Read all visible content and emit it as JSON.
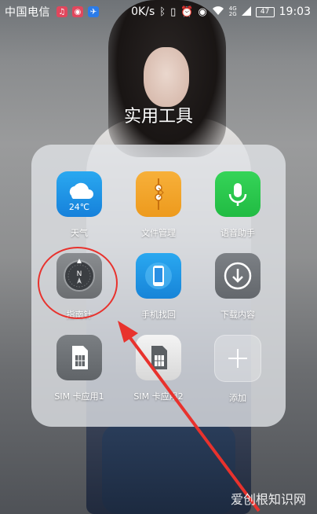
{
  "statusbar": {
    "carrier": "中国电信",
    "app_icons": [
      {
        "name": "music-app-icon",
        "color": "#e0475d"
      },
      {
        "name": "weibo-app-icon",
        "color": "#e0475d"
      },
      {
        "name": "sport-app-icon",
        "color": "#2b7be8"
      }
    ],
    "speed": "0K/s",
    "network_4g": "4G",
    "network_2g": "2G",
    "battery": "47",
    "time": "19:03"
  },
  "folder": {
    "title": "实用工具",
    "apps": [
      {
        "label": "天气",
        "icon": "weather-icon",
        "temp": "24℃"
      },
      {
        "label": "文件管理",
        "icon": "file-manager-icon"
      },
      {
        "label": "语音助手",
        "icon": "voice-assistant-icon"
      },
      {
        "label": "指南针",
        "icon": "compass-icon",
        "compass_letter": "N"
      },
      {
        "label": "手机找回",
        "icon": "find-phone-icon"
      },
      {
        "label": "下载内容",
        "icon": "download-icon"
      },
      {
        "label": "SIM 卡应用1",
        "icon": "sim-card-icon"
      },
      {
        "label": "SIM 卡应用2",
        "icon": "sim-card-icon"
      },
      {
        "label": "添加",
        "icon": "add-icon"
      }
    ]
  },
  "annotation": {
    "color": "#e8322d"
  },
  "watermark": "爱创根知识网"
}
